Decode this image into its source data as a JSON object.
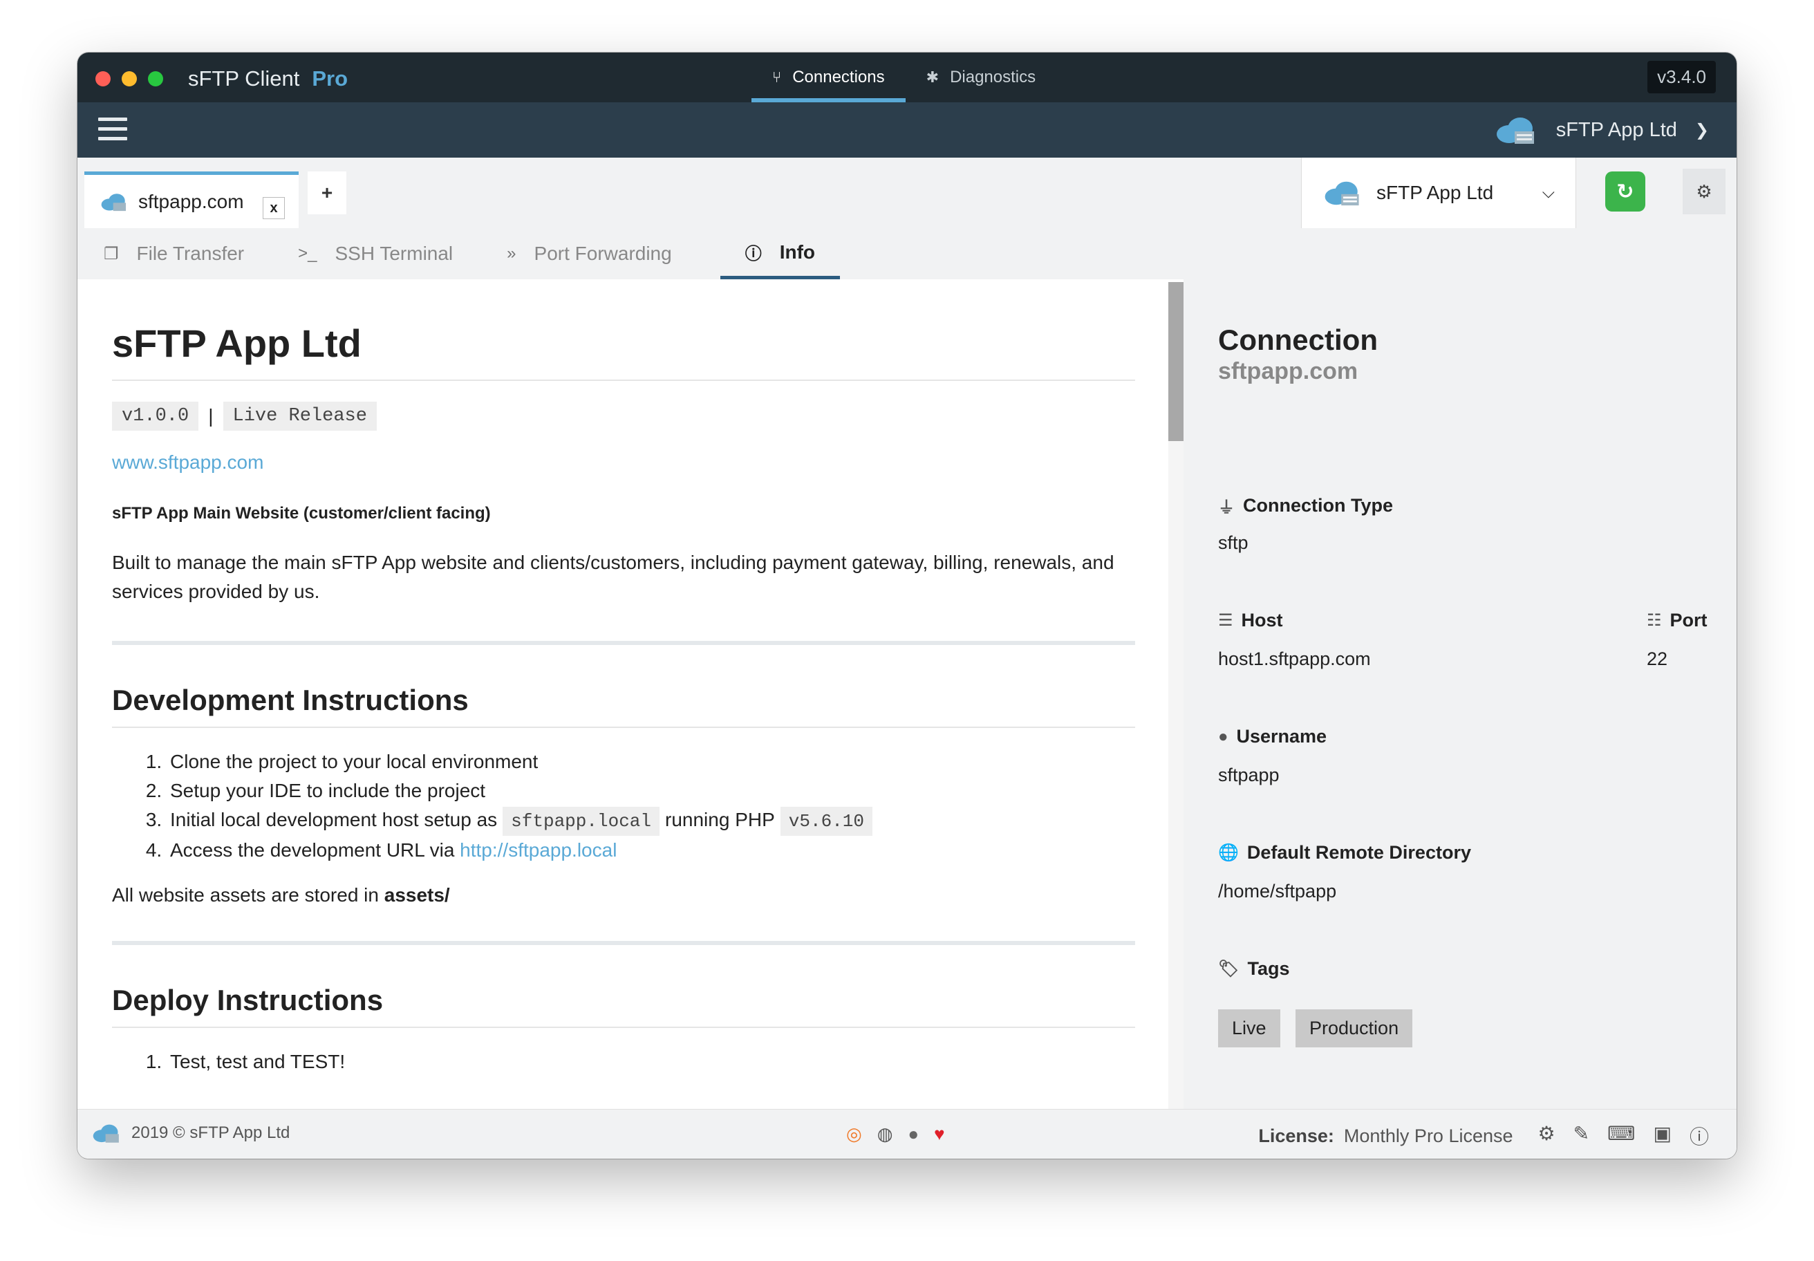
{
  "window": {
    "app_name": "sFTP Client",
    "app_edition": "Pro",
    "version": "v3.4.0",
    "nav": [
      {
        "label": "Connections",
        "icon": "branch-icon",
        "active": true
      },
      {
        "label": "Diagnostics",
        "icon": "bug-icon",
        "active": false
      }
    ]
  },
  "subheader": {
    "org_name": "sFTP App Ltd",
    "logo_text": "sFTP"
  },
  "tabbar": {
    "tab_label": "sftpapp.com",
    "close_label": "x",
    "add_label": "+",
    "org_name": "sFTP App Ltd"
  },
  "subtabs": [
    {
      "label": "File Transfer",
      "icon": "files-icon",
      "active": false
    },
    {
      "label": "SSH Terminal",
      "icon": "terminal-icon",
      "active": false
    },
    {
      "label": "Port Forwarding",
      "icon": "forward-icon",
      "active": false
    },
    {
      "label": "Info",
      "icon": "info-icon",
      "active": true
    }
  ],
  "doc": {
    "title": "sFTP App Ltd",
    "version_badge": "v1.0.0",
    "separator": "|",
    "release_badge": "Live Release",
    "site_link": "www.sftpapp.com",
    "subtitle": "sFTP App Main Website (customer/client facing)",
    "description": "Built to manage the main sFTP App website and clients/customers, including payment gateway, billing, renewals, and services provided by us.",
    "dev_heading": "Development Instructions",
    "dev_steps": {
      "step1": "Clone the project to your local environment",
      "step2": "Setup your IDE to include the project",
      "step3_prefix": "Initial local development host setup as",
      "step3_code1": "sftpapp.local",
      "step3_mid": "running PHP",
      "step3_code2": "v5.6.10",
      "step4_prefix": "Access the development URL via",
      "step4_link": "http://sftpapp.local"
    },
    "assets_prefix": "All website assets are stored in",
    "assets_dir": "assets/",
    "deploy_heading": "Deploy Instructions",
    "deploy_step1": "Test, test and TEST!"
  },
  "panel": {
    "title": "Connection",
    "host_display": "sftpapp.com",
    "connection_type_label": "Connection Type",
    "connection_type": "sftp",
    "host_label": "Host",
    "host": "host1.sftpapp.com",
    "port_label": "Port",
    "port": "22",
    "username_label": "Username",
    "username": "sftpapp",
    "remote_dir_label": "Default Remote Directory",
    "remote_dir": "/home/sftpapp",
    "tags_label": "Tags",
    "tags": [
      "Live",
      "Production"
    ]
  },
  "footer": {
    "copyright": "2019 © sFTP App Ltd",
    "license_label": "License:",
    "license_value": "Monthly Pro License"
  },
  "colors": {
    "accent": "#5aa9d6",
    "titlebar": "#1f2a31",
    "subheader": "#2c3e4c",
    "refresh_green": "#3cb44b",
    "heart": "#e0202a"
  }
}
